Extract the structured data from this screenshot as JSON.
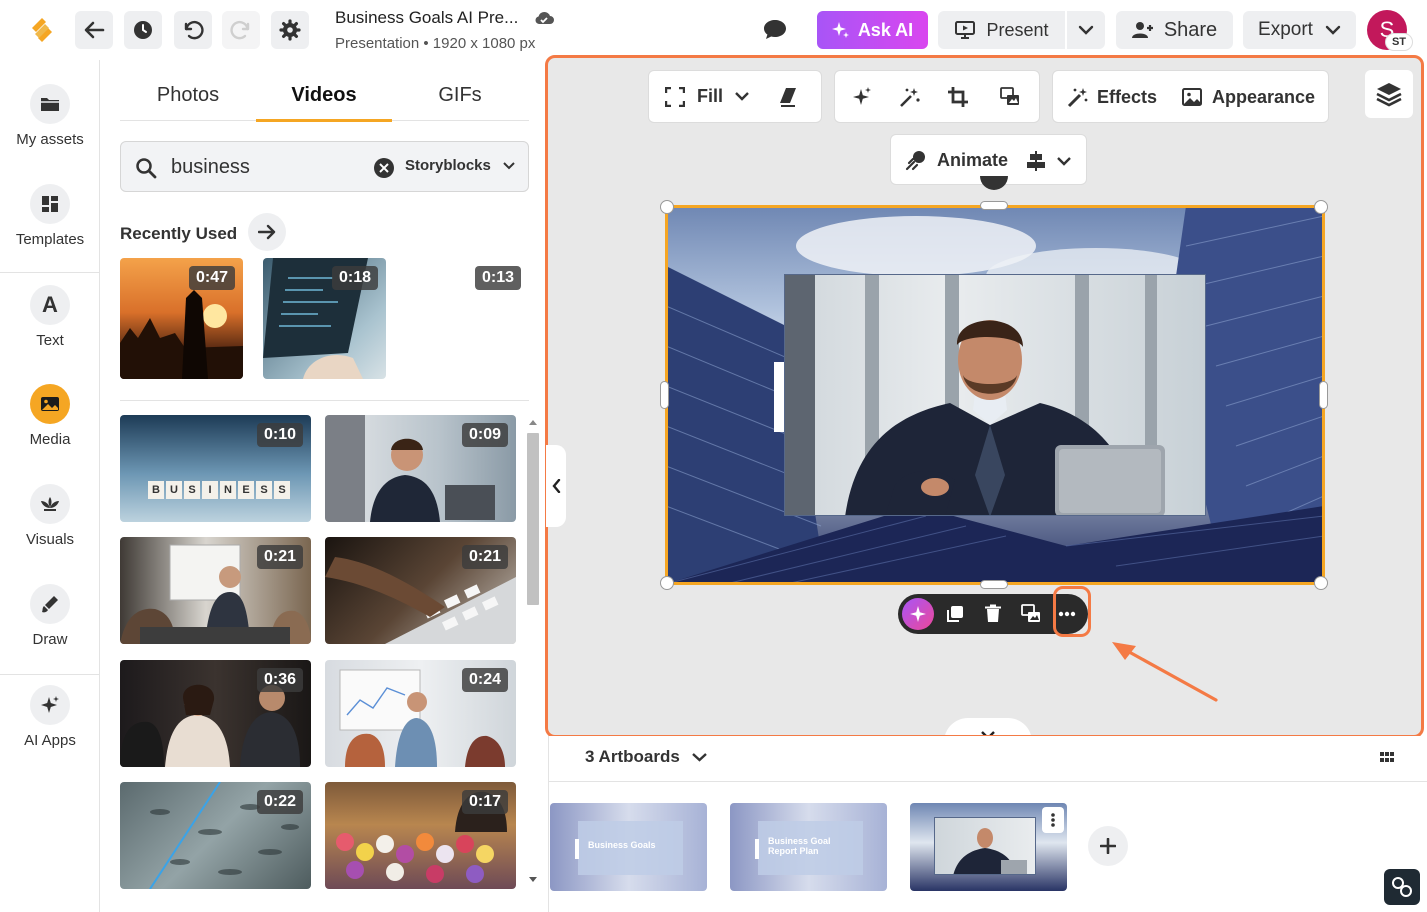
{
  "app": {
    "title": "Business Goals AI Pre...",
    "subtitle": "Presentation • 1920 x 1080 px",
    "ask_ai": "Ask AI",
    "present": "Present",
    "share": "Share",
    "export": "Export",
    "avatar_initial": "S",
    "avatar_badge": "ST"
  },
  "sidebar": {
    "items": [
      {
        "label": "My assets",
        "icon": "folder-icon"
      },
      {
        "label": "Templates",
        "icon": "templates-icon"
      },
      {
        "label": "Text",
        "icon": "text-icon",
        "glyph": "A"
      },
      {
        "label": "Media",
        "icon": "media-icon"
      },
      {
        "label": "Visuals",
        "icon": "visuals-icon"
      },
      {
        "label": "Draw",
        "icon": "draw-icon"
      },
      {
        "label": "AI Apps",
        "icon": "ai-apps-icon"
      }
    ]
  },
  "panel": {
    "tabs": [
      "Photos",
      "Videos",
      "GIFs"
    ],
    "active_tab": "Videos",
    "search_value": "business",
    "source": "Storyblocks",
    "recent_title": "Recently Used",
    "recent": [
      "0:47",
      "0:18",
      "0:13"
    ],
    "grid": [
      "0:10",
      "0:09",
      "0:21",
      "0:21",
      "0:36",
      "0:24",
      "0:22",
      "0:17"
    ],
    "dice_letters": [
      "B",
      "U",
      "S",
      "I",
      "N",
      "E",
      "S",
      "S"
    ]
  },
  "toolbar": {
    "fill": "Fill",
    "effects": "Effects",
    "appearance": "Appearance",
    "animate": "Animate"
  },
  "bottom": {
    "artboards_label": "3 Artboards",
    "artboards": [
      {
        "caption": "Business Goals"
      },
      {
        "caption": "Business Goal Report Plan"
      },
      {
        "caption": ""
      }
    ]
  },
  "colors": {
    "accent": "#f47a45",
    "ask_ai_start": "#a855f7",
    "ask_ai_end": "#d946ef",
    "avatar": "#c2185b",
    "media_active": "#f5a623"
  }
}
